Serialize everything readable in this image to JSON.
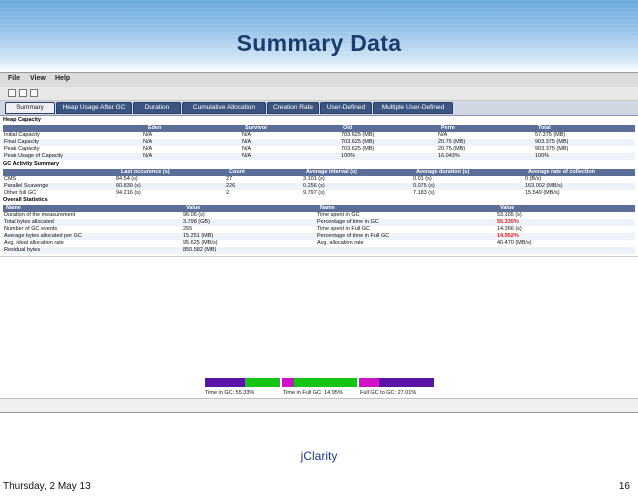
{
  "slide": {
    "title": "Summary Data",
    "footer_date": "Thursday, 2 May 13",
    "page_number": "16",
    "logo_text": "jClarity"
  },
  "menu": {
    "items": [
      "File",
      "View",
      "Help"
    ]
  },
  "tabs": {
    "items": [
      "Summary",
      "Heap Usage After GC",
      "Duration",
      "Cumulative Allocation",
      "Creation Rate",
      "User-Defined",
      "Multiple User-Defined"
    ],
    "active": "Summary"
  },
  "heap_capacity": {
    "section_title": "Heap Capacity",
    "columns": [
      "Eden",
      "Survivor",
      "Old",
      "Perm",
      "Total"
    ],
    "rows": [
      {
        "label": "Initial Capacity",
        "cells": [
          "N/A",
          "N/A",
          "703.625 (MB)",
          "N/A",
          "57.375 (MB)"
        ]
      },
      {
        "label": "Final Capacity",
        "cells": [
          "N/A",
          "N/A",
          "703.625 (MB)",
          "20.75 (MB)",
          "903.375 (MB)"
        ]
      },
      {
        "label": "Peak Capacity",
        "cells": [
          "N/A",
          "N/A",
          "703.625 (MB)",
          "20.75 (MB)",
          "903.375 (MB)"
        ]
      },
      {
        "label": "Peak Usage of Capacity",
        "cells": [
          "N/A",
          "N/A",
          "100%",
          "16.043%",
          "100%"
        ]
      }
    ]
  },
  "gc_activity": {
    "section_title": "GC Activity Summary",
    "columns": [
      "Last occurence (s)",
      "Count",
      "Average interval (s)",
      "Average duration (s)",
      "Average rate of collection"
    ],
    "rows": [
      {
        "label": "CMS",
        "cells": [
          "84.54 (s)",
          "27",
          "3.101 (s)",
          "0.01 (s)",
          "0 (B/s)"
        ]
      },
      {
        "label": "Parallel Scavenge",
        "cells": [
          "60.839 (s)",
          "226",
          "0.256 (s)",
          "0.075 (s)",
          "163.002 (MB/s)"
        ]
      },
      {
        "label": "Other full GC",
        "cells": [
          "94.216 (s)",
          "2",
          "9.797 (s)",
          "7.183 (s)",
          "15.549 (MB/s)"
        ]
      }
    ]
  },
  "overall": {
    "section_title": "Overall Statistics",
    "columns": [
      "Name",
      "Value",
      "Name",
      "Value"
    ],
    "rows": [
      {
        "name1": "Duration of the measurement",
        "value1": "96.06 (s)",
        "name2": "Time spent in GC",
        "value2": "53.165 (s)",
        "red": false
      },
      {
        "name1": "Total bytes allocated",
        "value1": "3.798 (GB)",
        "name2": "Percentage of time in GC",
        "value2": "55.335%",
        "red": true
      },
      {
        "name1": "Number of GC events",
        "value1": "255",
        "name2": "Time spent in Full GC",
        "value2": "14.366 (s)",
        "red": false
      },
      {
        "name1": "Average bytes allocated per GC",
        "value1": "15.251 (MB)",
        "name2": "Percentage of time in Full GC",
        "value2": "14.952%",
        "red": true
      },
      {
        "name1": "Avg. ideal allocation rate",
        "value1": "95.625 (MB/s)",
        "name2": "Avg. allocation rate",
        "value2": "40.470 (MB/s)",
        "red": false
      },
      {
        "name1": "Residual bytes",
        "value1": "850.582 (MB)",
        "name2": "",
        "value2": "",
        "red": false
      }
    ]
  },
  "gc_time_bar": {
    "segments": [
      {
        "label": "Time in GC: 55.33%",
        "color": "#5a12a8",
        "color2": "#15c415"
      },
      {
        "label": "Time in Full GC: 14.95%",
        "color": "#d011c8",
        "color2": "#15c415"
      },
      {
        "label": "Full GC to GC: 27.01%",
        "color": "#d011c8",
        "color2": "#5a12a8"
      }
    ]
  }
}
